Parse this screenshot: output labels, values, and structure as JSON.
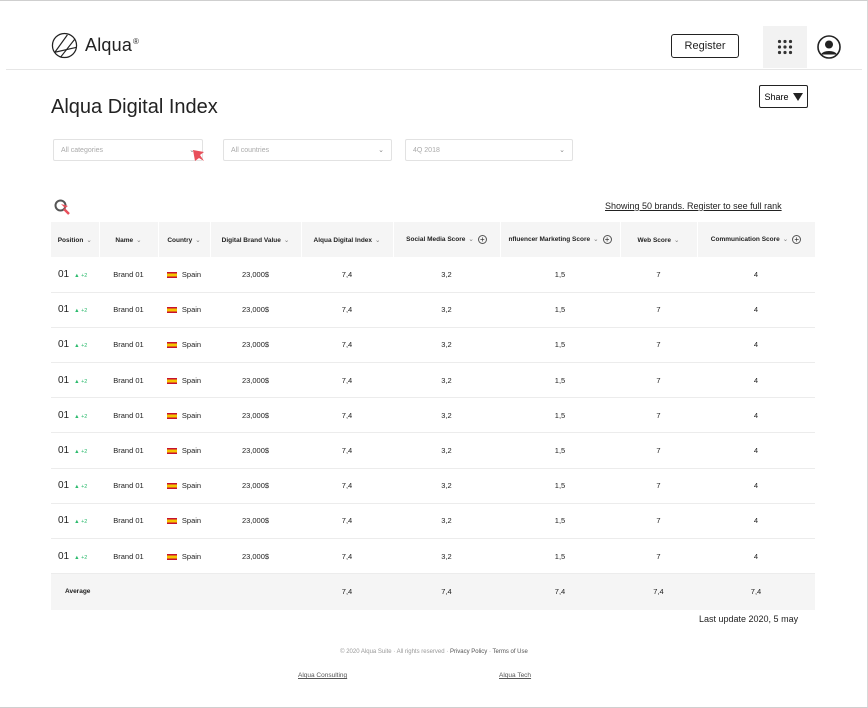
{
  "header": {
    "logo_text": "Alqua",
    "logo_reg": "®",
    "register_label": "Register"
  },
  "page": {
    "title": "Alqua Digital Index",
    "share_label": "Share"
  },
  "filters": {
    "category": "All categories",
    "country": "All countries",
    "period": "4Q 2018"
  },
  "showing_text": "Showing 50 brands. Register to see full rank",
  "table": {
    "headers": [
      "Position",
      "Name",
      "Country",
      "Digital Brand Value",
      "Alqua Digital Index",
      "Social Media Score",
      "nfluencer Marketing Score",
      "Web Score",
      "Communication Score"
    ],
    "rows": [
      {
        "position": "01",
        "delta": "▲ +2",
        "name": "Brand 01",
        "country": "Spain",
        "value": "23,000$",
        "index": "7,4",
        "social": "3,2",
        "influencer": "1,5",
        "web": "7",
        "communication": "4"
      },
      {
        "position": "01",
        "delta": "▲ +2",
        "name": "Brand 01",
        "country": "Spain",
        "value": "23,000$",
        "index": "7,4",
        "social": "3,2",
        "influencer": "1,5",
        "web": "7",
        "communication": "4"
      },
      {
        "position": "01",
        "delta": "▲ +2",
        "name": "Brand 01",
        "country": "Spain",
        "value": "23,000$",
        "index": "7,4",
        "social": "3,2",
        "influencer": "1,5",
        "web": "7",
        "communication": "4"
      },
      {
        "position": "01",
        "delta": "▲ +2",
        "name": "Brand 01",
        "country": "Spain",
        "value": "23,000$",
        "index": "7,4",
        "social": "3,2",
        "influencer": "1,5",
        "web": "7",
        "communication": "4"
      },
      {
        "position": "01",
        "delta": "▲ +2",
        "name": "Brand 01",
        "country": "Spain",
        "value": "23,000$",
        "index": "7,4",
        "social": "3,2",
        "influencer": "1,5",
        "web": "7",
        "communication": "4"
      },
      {
        "position": "01",
        "delta": "▲ +2",
        "name": "Brand 01",
        "country": "Spain",
        "value": "23,000$",
        "index": "7,4",
        "social": "3,2",
        "influencer": "1,5",
        "web": "7",
        "communication": "4"
      },
      {
        "position": "01",
        "delta": "▲ +2",
        "name": "Brand 01",
        "country": "Spain",
        "value": "23,000$",
        "index": "7,4",
        "social": "3,2",
        "influencer": "1,5",
        "web": "7",
        "communication": "4"
      },
      {
        "position": "01",
        "delta": "▲ +2",
        "name": "Brand 01",
        "country": "Spain",
        "value": "23,000$",
        "index": "7,4",
        "social": "3,2",
        "influencer": "1,5",
        "web": "7",
        "communication": "4"
      },
      {
        "position": "01",
        "delta": "▲ +2",
        "name": "Brand 01",
        "country": "Spain",
        "value": "23,000$",
        "index": "7,4",
        "social": "3,2",
        "influencer": "1,5",
        "web": "7",
        "communication": "4"
      }
    ],
    "average": {
      "label": "Average",
      "index": "7,4",
      "social": "7,4",
      "influencer": "7,4",
      "web": "7,4",
      "communication": "7,4"
    }
  },
  "last_update": "Last update 2020, 5 may",
  "footer": {
    "copyright": "© 2020 Alqua Suite · All rights reserved · ",
    "privacy": "Privacy Policy",
    "sep": " · ",
    "terms": "Terms of Use",
    "link_consulting": "Alqua Consulting",
    "link_tech": "Alqua Tech"
  },
  "colors": {
    "positive_delta": "#2dbb6e",
    "accent_red": "#e8505b"
  },
  "icons": [
    "logo-icon",
    "apps-grid-icon",
    "user-icon",
    "search-icon",
    "chevron-down-icon",
    "add-circle-icon",
    "flag-spain-icon"
  ]
}
